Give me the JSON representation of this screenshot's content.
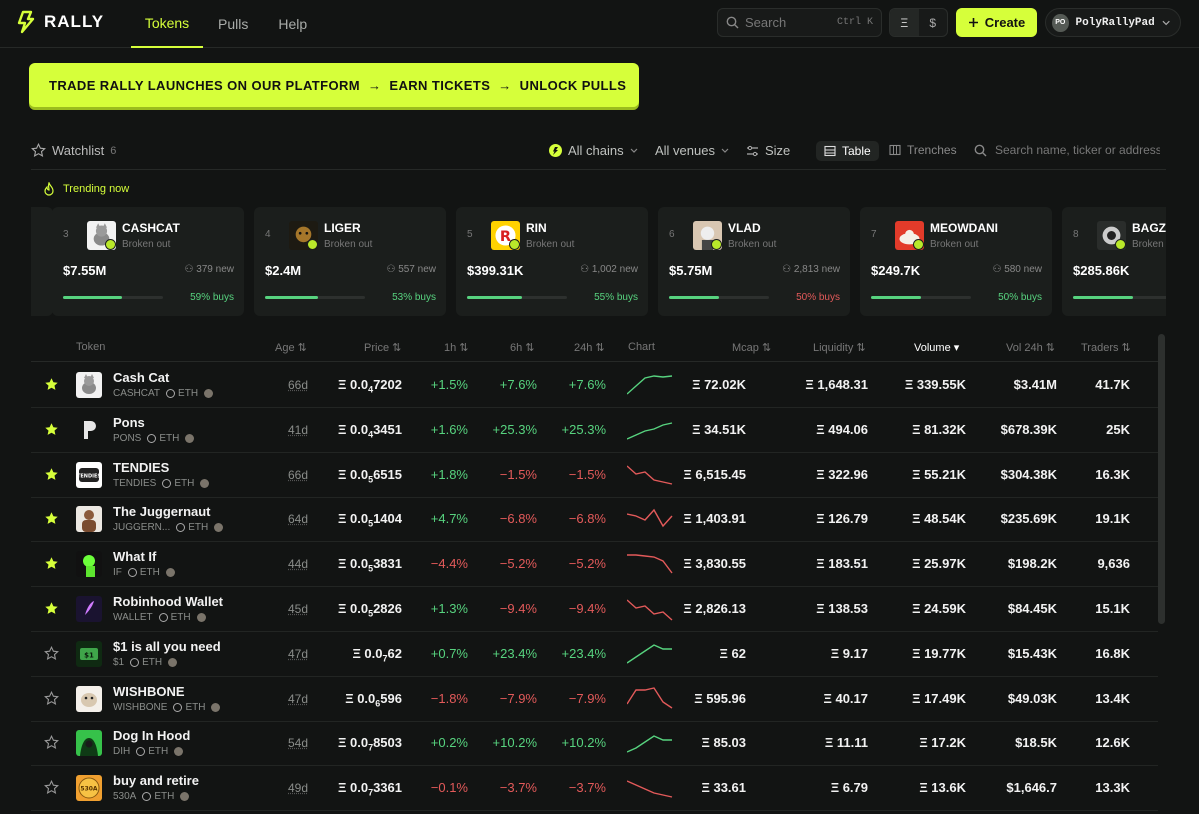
{
  "app": {
    "brand": "RALLY",
    "accent": "#d6ff3a"
  },
  "nav": {
    "tabs": [
      {
        "label": "Tokens",
        "active": true
      },
      {
        "label": "Pulls"
      },
      {
        "label": "Help"
      }
    ]
  },
  "header": {
    "search_placeholder": "Search",
    "search_shortcut": "Ctrl K",
    "currency_eth": "Ξ",
    "currency_usd": "$",
    "create_label": "Create",
    "user_initials": "PO",
    "user_name": "PolyRallyPad"
  },
  "banner": {
    "part1": "TRADE RALLY LAUNCHES ON OUR PLATFORM",
    "arrow": "→",
    "part2": "EARN TICKETS",
    "part3": "UNLOCK PULLS"
  },
  "controls": {
    "watchlist_label": "Watchlist",
    "watchlist_count": "6",
    "chains": "All chains",
    "venues": "All venues",
    "size": "Size",
    "table": "Table",
    "trenches": "Trenches",
    "search_placeholder": "Search name, ticker or address"
  },
  "trending": {
    "label": "Trending now",
    "cards": [
      {
        "rank": "3",
        "name": "CASHCAT",
        "status": "Broken out",
        "mcap": "$7.55M",
        "new": "379 new",
        "buys": "59% buys",
        "buys_pct": 59,
        "buys_color": "#57d37f",
        "img": "cashcat"
      },
      {
        "rank": "4",
        "name": "LIGER",
        "status": "Broken out",
        "mcap": "$2.4M",
        "new": "557 new",
        "buys": "53% buys",
        "buys_pct": 53,
        "buys_color": "#57d37f",
        "img": "liger"
      },
      {
        "rank": "5",
        "name": "RIN",
        "status": "Broken out",
        "mcap": "$399.31K",
        "new": "1,002 new",
        "buys": "55% buys",
        "buys_pct": 55,
        "buys_color": "#57d37f",
        "img": "rin"
      },
      {
        "rank": "6",
        "name": "VLAD",
        "status": "Broken out",
        "mcap": "$5.75M",
        "new": "2,813 new",
        "buys": "50% buys",
        "buys_pct": 50,
        "buys_color": "#e35a5a",
        "img": "vlad"
      },
      {
        "rank": "7",
        "name": "MEOWDANI",
        "status": "Broken out",
        "mcap": "$249.7K",
        "new": "580 new",
        "buys": "50% buys",
        "buys_pct": 50,
        "buys_color": "#57d37f",
        "img": "meow"
      },
      {
        "rank": "8",
        "name": "BAGZ",
        "status": "Broken out",
        "mcap": "$285.86K",
        "new": "",
        "buys": "",
        "buys_pct": 60,
        "buys_color": "#57d37f",
        "img": "bagz"
      }
    ]
  },
  "table": {
    "headers": {
      "token": "Token",
      "age": "Age",
      "price": "Price",
      "h1": "1h",
      "h6": "6h",
      "h24": "24h",
      "chart": "Chart",
      "mcap": "Mcap",
      "liquidity": "Liquidity",
      "volume": "Volume",
      "vol24": "Vol 24h",
      "traders": "Traders"
    },
    "rows": [
      {
        "starred": true,
        "name": "Cash Cat",
        "ticker": "CASHCAT",
        "chain": "ETH",
        "age": "66d",
        "price_pre": "Ξ 0.0",
        "price_sub": "4",
        "price_post": "7202",
        "h1": "+1.5%",
        "h6": "+7.6%",
        "h24": "+7.6%",
        "trend": "up",
        "spark": [
          22,
          14,
          6,
          4,
          5,
          4
        ],
        "mcap": "Ξ 72.02K",
        "liq": "Ξ 1,648.31",
        "vol": "Ξ 339.55K",
        "vol24": "$3.41M",
        "traders": "41.7K",
        "img": "cashcat"
      },
      {
        "starred": true,
        "name": "Pons",
        "ticker": "PONS",
        "chain": "ETH",
        "age": "41d",
        "price_pre": "Ξ 0.0",
        "price_sub": "4",
        "price_post": "3451",
        "h1": "+1.6%",
        "h6": "+25.3%",
        "h24": "+25.3%",
        "trend": "up",
        "spark": [
          22,
          18,
          14,
          12,
          8,
          6
        ],
        "mcap": "Ξ 34.51K",
        "liq": "Ξ 494.06",
        "vol": "Ξ 81.32K",
        "vol24": "$678.39K",
        "traders": "25K",
        "img": "pons"
      },
      {
        "starred": true,
        "name": "TENDIES",
        "ticker": "TENDIES",
        "chain": "ETH",
        "age": "66d",
        "price_pre": "Ξ 0.0",
        "price_sub": "5",
        "price_post": "6515",
        "h1": "+1.8%",
        "h6": "−1.5%",
        "h24": "−1.5%",
        "trend": "down",
        "spark": [
          4,
          12,
          10,
          18,
          20,
          22
        ],
        "mcap": "Ξ 6,515.45",
        "liq": "Ξ 322.96",
        "vol": "Ξ 55.21K",
        "vol24": "$304.38K",
        "traders": "16.3K",
        "img": "tendies"
      },
      {
        "starred": true,
        "name": "The Juggernaut",
        "ticker": "JUGGERN...",
        "chain": "ETH",
        "age": "64d",
        "price_pre": "Ξ 0.0",
        "price_sub": "5",
        "price_post": "1404",
        "h1": "+4.7%",
        "h6": "−6.8%",
        "h24": "−6.8%",
        "trend": "down",
        "spark": [
          8,
          10,
          14,
          4,
          20,
          10
        ],
        "mcap": "Ξ 1,403.91",
        "liq": "Ξ 126.79",
        "vol": "Ξ 48.54K",
        "vol24": "$235.69K",
        "traders": "19.1K",
        "img": "jugg"
      },
      {
        "starred": true,
        "name": "What If",
        "ticker": "IF",
        "chain": "ETH",
        "age": "44d",
        "price_pre": "Ξ 0.0",
        "price_sub": "5",
        "price_post": "3831",
        "h1": "−4.4%",
        "h6": "−5.2%",
        "h24": "−5.2%",
        "trend": "down",
        "spark": [
          4,
          4,
          5,
          6,
          10,
          22
        ],
        "mcap": "Ξ 3,830.55",
        "liq": "Ξ 183.51",
        "vol": "Ξ 25.97K",
        "vol24": "$198.2K",
        "traders": "9,636",
        "img": "whatif"
      },
      {
        "starred": true,
        "name": "Robinhood Wallet",
        "ticker": "WALLET",
        "chain": "ETH",
        "age": "45d",
        "price_pre": "Ξ 0.0",
        "price_sub": "5",
        "price_post": "2826",
        "h1": "+1.3%",
        "h6": "−9.4%",
        "h24": "−9.4%",
        "trend": "down",
        "spark": [
          4,
          12,
          10,
          18,
          16,
          24
        ],
        "mcap": "Ξ 2,826.13",
        "liq": "Ξ 138.53",
        "vol": "Ξ 24.59K",
        "vol24": "$84.45K",
        "traders": "15.1K",
        "img": "robin"
      },
      {
        "starred": false,
        "name": "$1 is all you need",
        "ticker": "$1",
        "chain": "ETH",
        "age": "47d",
        "price_pre": "Ξ 0.0",
        "price_sub": "7",
        "price_post": "62",
        "h1": "+0.7%",
        "h6": "+23.4%",
        "h24": "+23.4%",
        "trend": "up",
        "spark": [
          22,
          16,
          10,
          4,
          8,
          8
        ],
        "mcap": "Ξ 62",
        "liq": "Ξ 9.17",
        "vol": "Ξ 19.77K",
        "vol24": "$15.43K",
        "traders": "16.8K",
        "img": "dollar"
      },
      {
        "starred": false,
        "name": "WISHBONE",
        "ticker": "WISHBONE",
        "chain": "ETH",
        "age": "47d",
        "price_pre": "Ξ 0.0",
        "price_sub": "6",
        "price_post": "596",
        "h1": "−1.8%",
        "h6": "−7.9%",
        "h24": "−7.9%",
        "trend": "down",
        "spark": [
          18,
          4,
          4,
          2,
          16,
          22
        ],
        "mcap": "Ξ 595.96",
        "liq": "Ξ 40.17",
        "vol": "Ξ 17.49K",
        "vol24": "$49.03K",
        "traders": "13.4K",
        "img": "wish"
      },
      {
        "starred": false,
        "name": "Dog In Hood",
        "ticker": "DIH",
        "chain": "ETH",
        "age": "54d",
        "price_pre": "Ξ 0.0",
        "price_sub": "7",
        "price_post": "8503",
        "h1": "+0.2%",
        "h6": "+10.2%",
        "h24": "+10.2%",
        "trend": "up",
        "spark": [
          22,
          18,
          12,
          6,
          10,
          10
        ],
        "mcap": "Ξ 85.03",
        "liq": "Ξ 11.11",
        "vol": "Ξ 17.2K",
        "vol24": "$18.5K",
        "traders": "12.6K",
        "img": "dih"
      },
      {
        "starred": false,
        "name": "buy and retire",
        "ticker": "530A",
        "chain": "ETH",
        "age": "49d",
        "price_pre": "Ξ 0.0",
        "price_sub": "7",
        "price_post": "3361",
        "h1": "−0.1%",
        "h6": "−3.7%",
        "h24": "−3.7%",
        "trend": "down",
        "spark": [
          6,
          10,
          14,
          18,
          20,
          22
        ],
        "mcap": "Ξ 33.61",
        "liq": "Ξ 6.79",
        "vol": "Ξ 13.6K",
        "vol24": "$1,646.7",
        "traders": "13.3K",
        "img": "retire"
      }
    ]
  }
}
